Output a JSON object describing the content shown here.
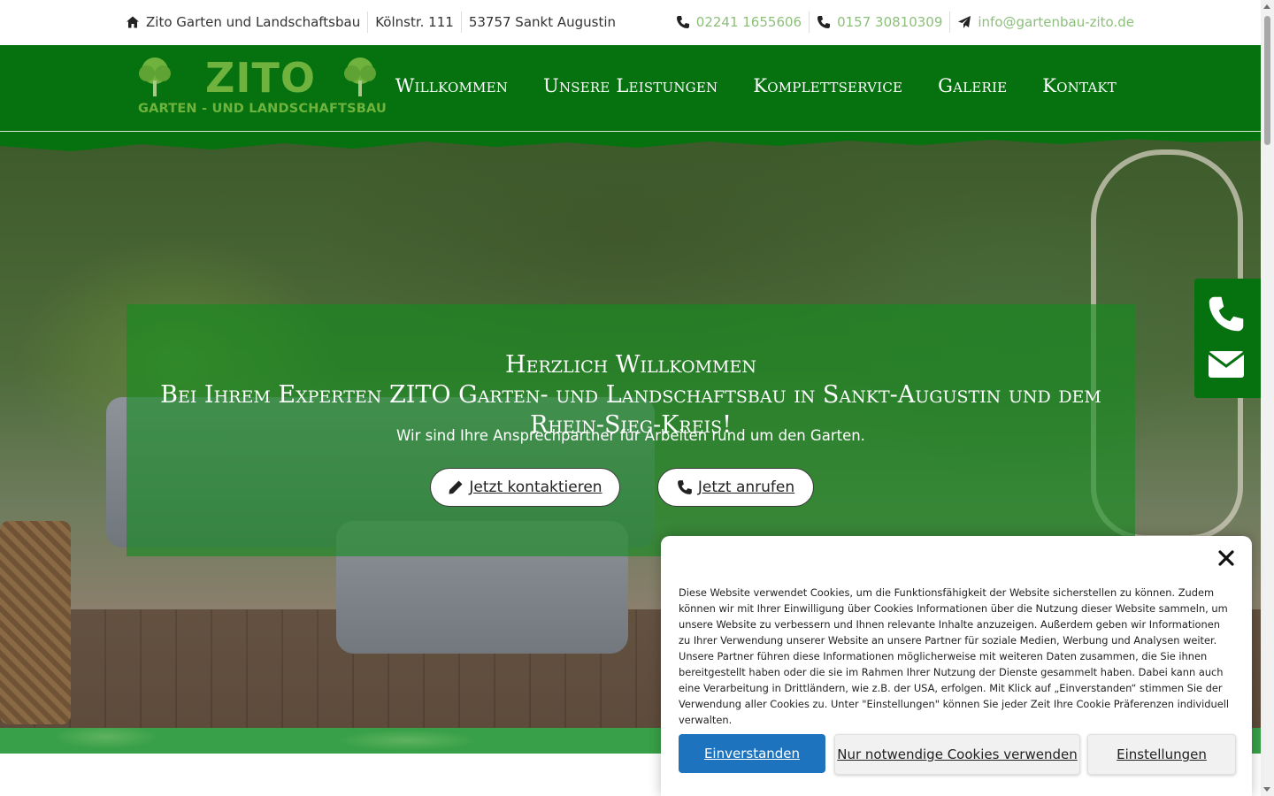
{
  "topbar": {
    "company": "Zito Garten und Landschaftsbau",
    "street": "Kölnstr. 111",
    "city": "53757 Sankt Augustin",
    "phone1": "02241 1655606",
    "phone2": "0157 30810309",
    "email": "info@gartenbau-zito.de"
  },
  "logo": {
    "brand": "ZITO",
    "subtitle": "GARTEN - UND LANDSCHAFTSBAU"
  },
  "nav": {
    "items": [
      "Willkommen",
      "Unsere Leistungen",
      "Komplettservice",
      "Galerie",
      "Kontakt"
    ]
  },
  "hero": {
    "title_line1": "Herzlich Willkommen",
    "title_line2": "Bei Ihrem Experten ZITO Garten- und Landschaftsbau in Sankt-Augustin und dem Rhein-Sieg-Kreis!",
    "subtitle": "Wir sind Ihre Ansprechpartner für Arbeiten rund um den Garten.",
    "btn_contact": "Jetzt kontaktieren",
    "btn_call": "Jetzt anrufen"
  },
  "cookie": {
    "text": "Diese Website verwendet Cookies, um die Funktionsfähigkeit der Website sicherstellen zu können. Zudem können wir mit Ihrer Einwilligung über Cookies Informationen über die Nutzung dieser Website sammeln, um unsere Website zu verbessern und Ihnen relevante Inhalte anzuzeigen. Außerdem geben wir Informationen zu Ihrer Verwendung unserer Website an unsere Partner für soziale Medien, Werbung und Analysen weiter. Unsere Partner führen diese Informationen möglicherweise mit weiteren Daten zusammen, die Sie ihnen bereitgestellt haben oder die sie im Rahmen Ihrer Nutzung der Dienste gesammelt haben. Dabei kann auch eine Verarbeitung in Drittländern, wie z.B. der USA, erfolgen. Mit Klick auf „Einverstanden“ stimmen Sie der Verwendung aller Cookies zu. Unter \"Einstellungen\" können Sie jeder Zeit Ihre Cookie Präferenzen individuell verwalten.",
    "accept": "Einverstanden",
    "necessary": "Nur notwendige Cookies verwenden",
    "settings": "Einstellungen"
  },
  "colors": {
    "brand_green": "#05720f",
    "logo_green": "#6fb33e",
    "link_green": "#8bbf7a",
    "accept_blue": "#1e73be"
  },
  "icons": [
    "home-icon",
    "phone-icon",
    "paper-plane-icon",
    "pencil-icon",
    "envelope-icon",
    "close-icon",
    "tree-icon"
  ]
}
